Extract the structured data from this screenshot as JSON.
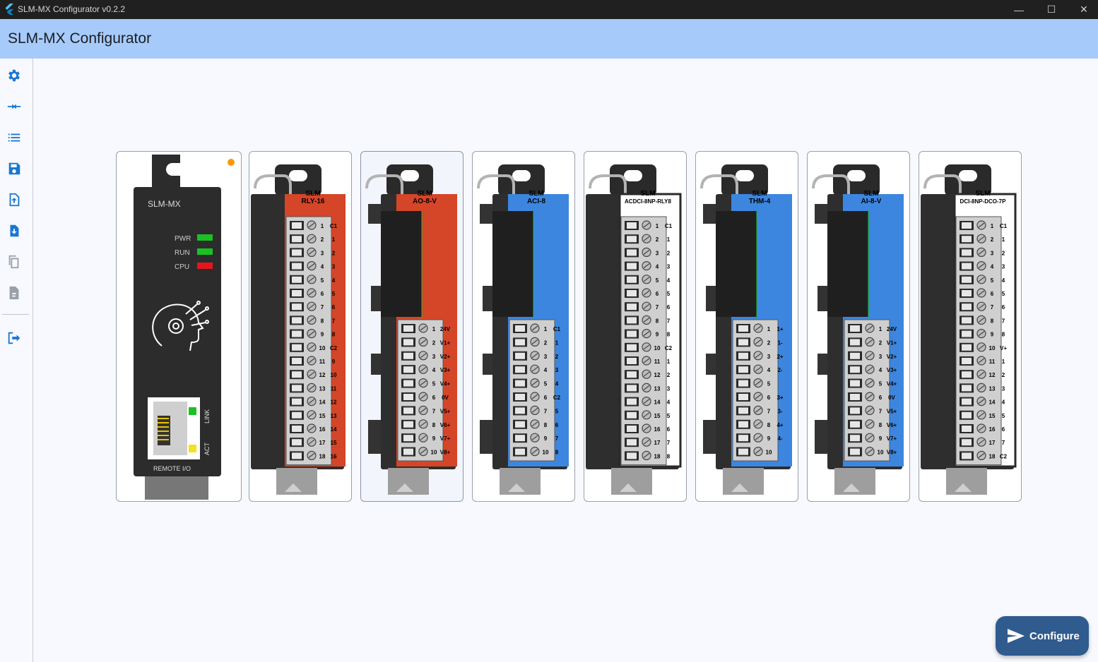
{
  "window": {
    "title": "SLM-MX Configurator v0.2.2",
    "minimize": "—",
    "maximize": "☐",
    "close": "✕"
  },
  "appbar": {
    "title": "SLM-MX Configurator"
  },
  "rail": {
    "items": [
      "settings-icon",
      "compare-arrows-icon",
      "list-icon",
      "save-icon",
      "upload-file-icon",
      "download-file-icon",
      "copy-icon",
      "export-file-icon",
      "logout-icon"
    ]
  },
  "cpu": {
    "brand": "SLM-MX",
    "leds": [
      "PWR",
      "RUN",
      "CPU"
    ],
    "link": "LINK",
    "act": "ACT",
    "remote": "REMOTE I/O",
    "colors": {
      "pwr": "#19c222",
      "run": "#19c222",
      "cpu": "#e8141c",
      "status_dot": "#ff9800"
    }
  },
  "modules": [
    {
      "brand": "SLM",
      "name": "RLY-16",
      "color": "#d54528",
      "labels": [
        "C1",
        "1",
        "2",
        "3",
        "4",
        "5",
        "6",
        "7",
        "8",
        "C2",
        "9",
        "10",
        "11",
        "12",
        "13",
        "14",
        "15",
        "16"
      ]
    },
    {
      "brand": "SLM",
      "name": "AO-8-V",
      "color": "#d54528",
      "labels": [
        "24V",
        "V1+",
        "V2+",
        "V3+",
        "V4+",
        "0V",
        "V5+",
        "V6+",
        "V7+",
        "V8+"
      ]
    },
    {
      "brand": "SLM",
      "name": "ACI-8",
      "color": "#3d86df",
      "labels": [
        "C1",
        "1",
        "2",
        "3",
        "4",
        "C2",
        "5",
        "6",
        "7",
        "8"
      ]
    },
    {
      "brand": "SLM",
      "name": "ACDCI-8NP-RLY8",
      "color": "#ffffff",
      "labels": [
        "C1",
        "1",
        "2",
        "3",
        "4",
        "5",
        "6",
        "7",
        "8",
        "C2",
        "1",
        "2",
        "3",
        "4",
        "5",
        "6",
        "7",
        "8"
      ]
    },
    {
      "brand": "SLM",
      "name": "THM-4",
      "color": "#3d86df",
      "labels": [
        "1+",
        "1-",
        "2+",
        "2-",
        "",
        "3+",
        "3-",
        "4+",
        "4-",
        ""
      ]
    },
    {
      "brand": "SLM",
      "name": "AI-8-V",
      "color": "#3d86df",
      "labels": [
        "24V",
        "V1+",
        "V2+",
        "V3+",
        "V4+",
        "0V",
        "V5+",
        "V6+",
        "V7+",
        "V8+"
      ]
    },
    {
      "brand": "SLM",
      "name": "DCI-8NP-DCO-7P",
      "color": "#ffffff",
      "labels": [
        "C1",
        "1",
        "2",
        "3",
        "4",
        "5",
        "6",
        "7",
        "8",
        "V+",
        "1",
        "2",
        "3",
        "4",
        "5",
        "6",
        "7",
        "C2"
      ]
    }
  ],
  "actions": {
    "configure": "Configure"
  }
}
